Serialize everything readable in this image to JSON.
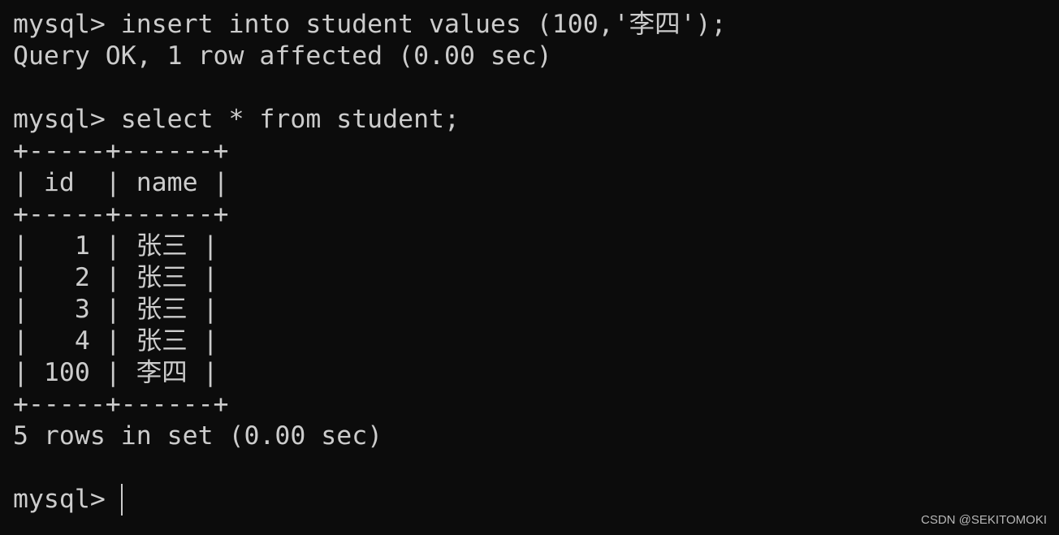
{
  "terminal": {
    "lines": [
      "mysql> insert into student values (100,'李四');",
      "Query OK, 1 row affected (0.00 sec)",
      "",
      "mysql> select * from student;",
      "+-----+------+",
      "| id  | name |",
      "+-----+------+",
      "|   1 | 张三 |",
      "|   2 | 张三 |",
      "|   3 | 张三 |",
      "|   4 | 张三 |",
      "| 100 | 李四 |",
      "+-----+------+",
      "5 rows in set (0.00 sec)",
      ""
    ],
    "prompt": "mysql> "
  },
  "watermark": "CSDN @SEKITOMOKI",
  "colors": {
    "background": "#0c0c0c",
    "text": "#cccccc"
  }
}
